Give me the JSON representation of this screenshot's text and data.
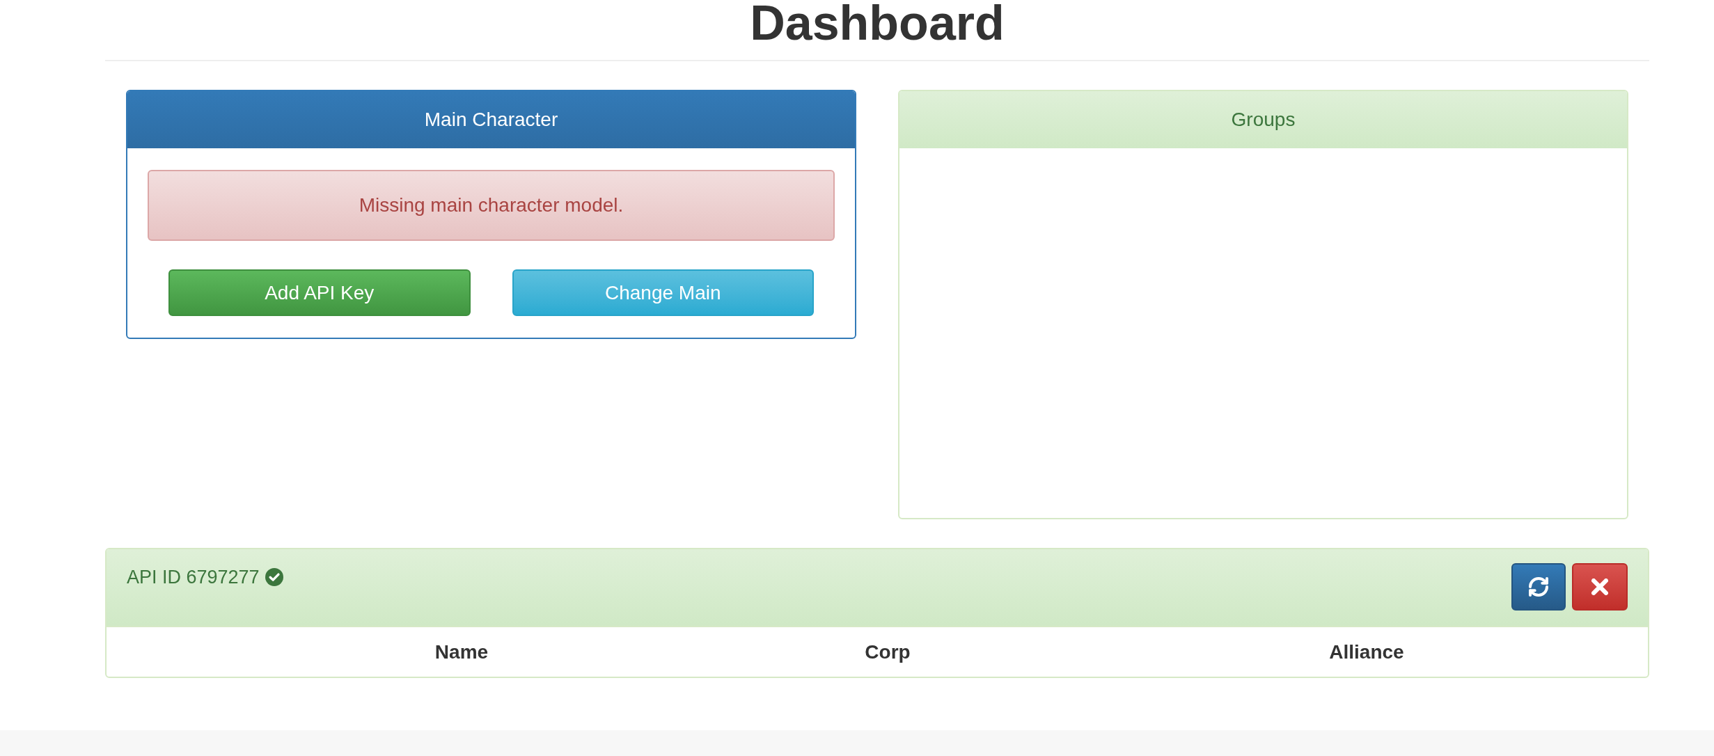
{
  "page": {
    "title": "Dashboard"
  },
  "main_character": {
    "title": "Main Character",
    "alert": "Missing main character model.",
    "buttons": [
      {
        "label": "Add API Key",
        "kind": "success"
      },
      {
        "label": "Change Main",
        "kind": "info"
      }
    ]
  },
  "groups": {
    "title": "Groups"
  },
  "api_keys": [
    {
      "title": "API ID 6797277",
      "verified": true,
      "columns": [
        "Name",
        "Corp",
        "Alliance"
      ]
    }
  ]
}
